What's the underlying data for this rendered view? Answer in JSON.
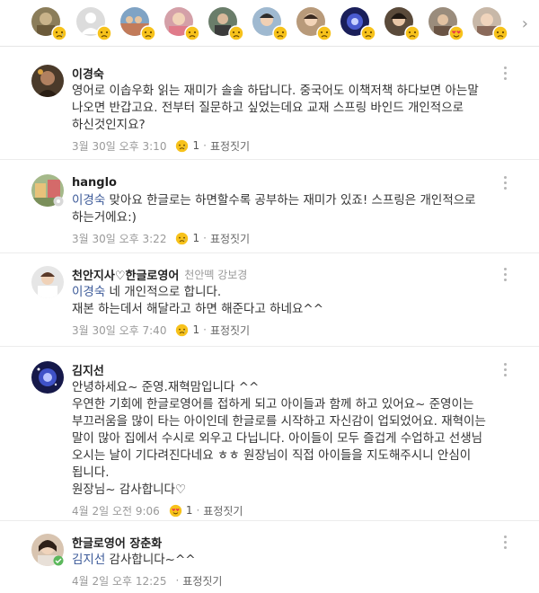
{
  "reactors": [
    {
      "name": "reactor-1",
      "reaction": "sad"
    },
    {
      "name": "reactor-2",
      "reaction": "sad"
    },
    {
      "name": "reactor-3",
      "reaction": "sad"
    },
    {
      "name": "reactor-4",
      "reaction": "sad"
    },
    {
      "name": "reactor-5",
      "reaction": "sad"
    },
    {
      "name": "reactor-6",
      "reaction": "sad"
    },
    {
      "name": "reactor-7",
      "reaction": "sad"
    },
    {
      "name": "reactor-8",
      "reaction": "sad"
    },
    {
      "name": "reactor-9",
      "reaction": "sad"
    },
    {
      "name": "reactor-10",
      "reaction": "love"
    }
  ],
  "comments": [
    {
      "author": "이경숙",
      "text": "영어로 이솝우화 읽는 재미가 솔솔 하답니다. 중국어도 이책저책 하다보면 아는말 나오면 반갑고요. 전부터 질문하고 싶었는데요  교재 스프링 바인드 개인적으로 하신것인지요?",
      "date": "3월 30일 오후 3:10",
      "reaction_count": "1",
      "action": "표정짓기"
    },
    {
      "author": "hanglo",
      "mention": "이경숙",
      "text": " 맞아요 한글로는 하면할수록 공부하는 재미가 있죠! 스프링은 개인적으로 하는거에요:)",
      "date": "3월 30일 오후 3:22",
      "reaction_count": "1",
      "action": "표정짓기"
    },
    {
      "author": "천안지사♡한글로영어",
      "sub": "천안뗵 강보경",
      "mention": "이경숙",
      "text": " 네 개인적으로 합니다.",
      "text2": "재본 하는데서 해달라고 하면 해준다고 하네요^^",
      "date": "3월 30일 오후 7:40",
      "reaction_count": "1",
      "action": "표정짓기"
    },
    {
      "author": "김지선",
      "lines": [
        "안녕하세요~ 준영.재혁맘입니다 ^^",
        "우연한 기회에 한글로영어를 접하게 되고 아이들과 함께 하고 있어요~ 준영이는 부끄러움을 많이 타는 아이인데 한글로를 시작하고 자신감이 업되었어요. 재혁이는 말이 많아 집에서 수시로 외우고 다닙니다. 아이들이 모두 즐겁게 수업하고 선생님 오시는 날이 기다려진다네요 ㅎㅎ 원장님이 직접 아이들을 지도해주시니 안심이 됩니다.",
        "원장님~ 감사합니다♡"
      ],
      "date": "4월 2일 오전 9:06",
      "reaction_count": "1",
      "action": "표정짓기"
    },
    {
      "author": "한글로영어 장춘화",
      "mention": "김지선",
      "text": " 감사합니다~^^",
      "date": "4월 2일 오후 12:25",
      "action": "표정짓기"
    }
  ],
  "colors": {
    "mention": "#3b5998",
    "meta": "#999999",
    "divider": "#ececec"
  }
}
